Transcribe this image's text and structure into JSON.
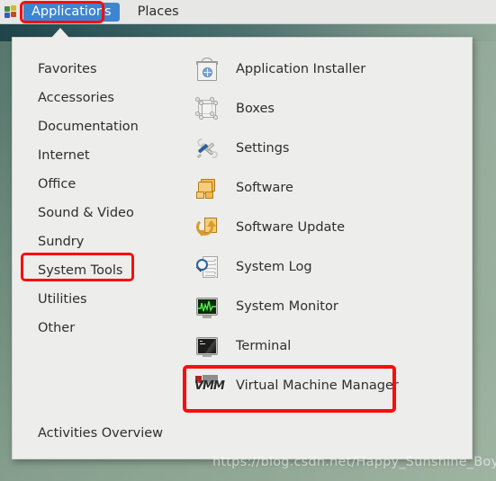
{
  "topbar": {
    "logo_icon": "gnome-footprint-logo",
    "applications_label": "Applications",
    "places_label": "Places"
  },
  "menu": {
    "categories": [
      {
        "label": "Favorites",
        "name": "favorites"
      },
      {
        "label": "Accessories",
        "name": "accessories"
      },
      {
        "label": "Documentation",
        "name": "documentation"
      },
      {
        "label": "Internet",
        "name": "internet"
      },
      {
        "label": "Office",
        "name": "office"
      },
      {
        "label": "Sound & Video",
        "name": "sound-video"
      },
      {
        "label": "Sundry",
        "name": "sundry"
      },
      {
        "label": "System Tools",
        "name": "system-tools"
      },
      {
        "label": "Utilities",
        "name": "utilities"
      },
      {
        "label": "Other",
        "name": "other"
      }
    ],
    "apps": [
      {
        "label": "Application Installer",
        "icon": "shopping-bag-icon"
      },
      {
        "label": "Boxes",
        "icon": "wireframe-cube-icon"
      },
      {
        "label": "Settings",
        "icon": "wrench-screwdriver-icon"
      },
      {
        "label": "Software",
        "icon": "orange-boxes-icon"
      },
      {
        "label": "Software Update",
        "icon": "refresh-page-icon"
      },
      {
        "label": "System Log",
        "icon": "magnifier-page-icon"
      },
      {
        "label": "System Monitor",
        "icon": "monitor-waveform-icon"
      },
      {
        "label": "Terminal",
        "icon": "terminal-icon"
      },
      {
        "label": "Virtual Machine Manager",
        "icon": "vmm-letters-icon"
      }
    ],
    "footer_label": "Activities Overview"
  },
  "annotations": {
    "color": "#fb0d0d",
    "targets": [
      "Applications",
      "System Tools",
      "Virtual Machine Manager"
    ]
  },
  "watermark": {
    "text": "https://blog.csdn.net/Happy_Sunshine_Boy"
  },
  "colors": {
    "topbar_bg": "#e7e7e5",
    "panel_bg": "#ededeb",
    "accent_blue": "#3d85d0",
    "annotation_red": "#fb0d0d",
    "desktop_green": "#829c8c"
  }
}
